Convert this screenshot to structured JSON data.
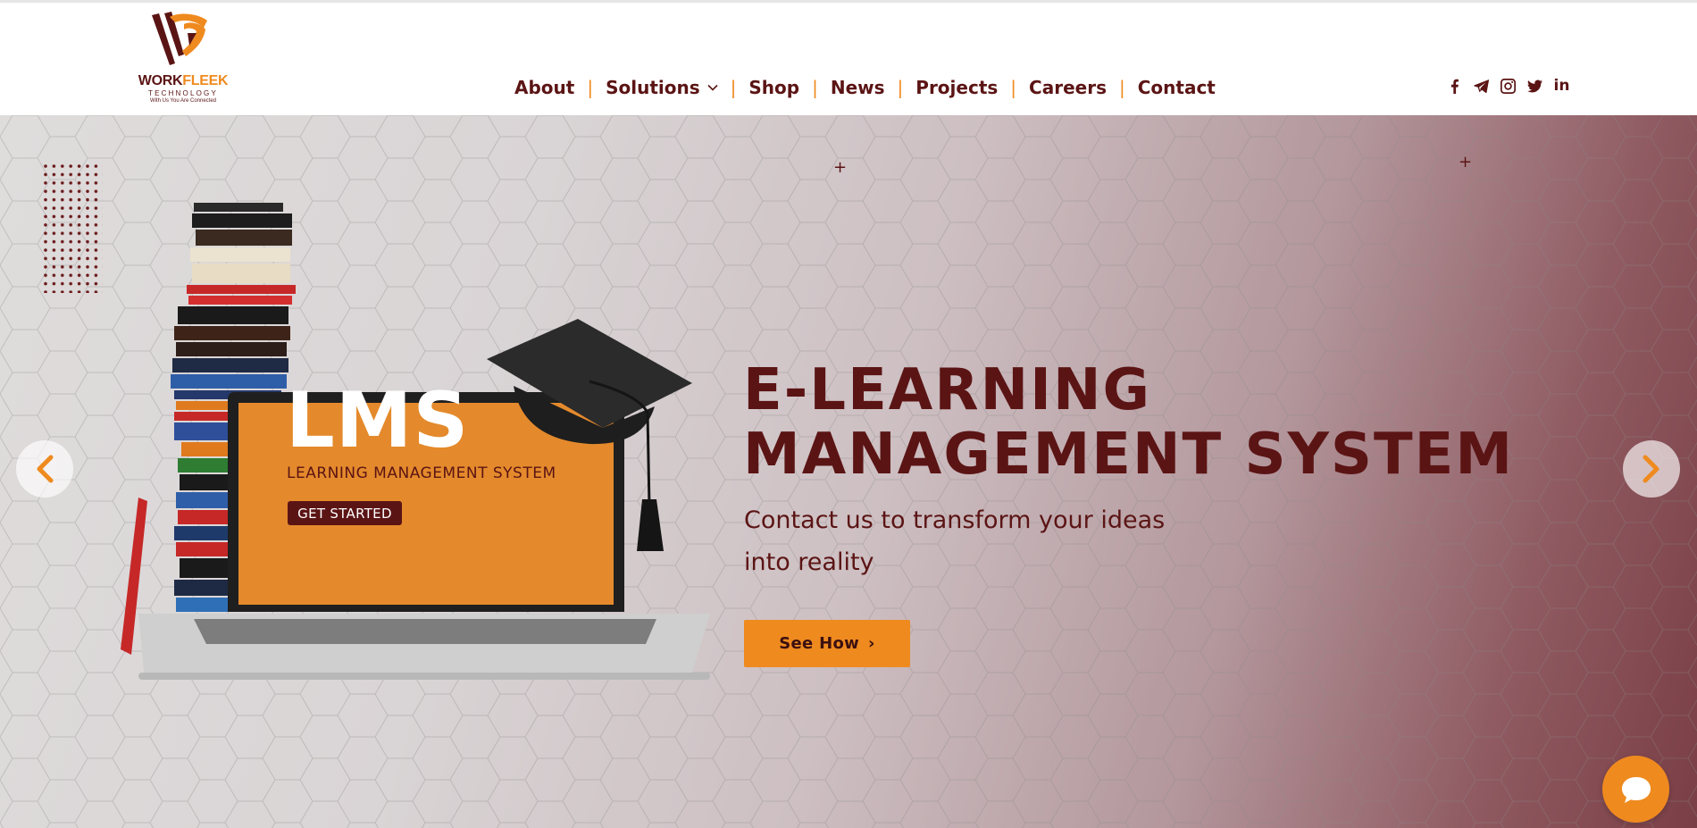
{
  "brand": {
    "word_main": "WORK",
    "word_accent": "FLEEK",
    "sub": "TECHNOLOGY",
    "tagline": "With Us You Are Connected"
  },
  "nav": {
    "items": [
      {
        "label": "About"
      },
      {
        "label": "Solutions"
      },
      {
        "label": "Shop"
      },
      {
        "label": "News"
      },
      {
        "label": "Projects"
      },
      {
        "label": "Careers"
      },
      {
        "label": "Contact"
      }
    ],
    "separator": "|"
  },
  "social": {
    "icons": [
      "facebook-icon",
      "telegram-icon",
      "instagram-icon",
      "twitter-icon",
      "linkedin-icon"
    ],
    "linkedin_text": "in"
  },
  "hero": {
    "screen_title": "LMS",
    "screen_subtitle": "LEARNING MANAGEMENT SYSTEM",
    "screen_button": "GET STARTED",
    "title_line1": "E-LEARNING",
    "title_line2": "MANAGEMENT SYSTEM",
    "subtitle_line1": "Contact us to transform your ideas",
    "subtitle_line2": "into reality",
    "cta_label": "See How",
    "cta_arrow": "›"
  },
  "colors": {
    "brand_dark": "#5b1414",
    "brand_orange": "#ef8a1f"
  }
}
